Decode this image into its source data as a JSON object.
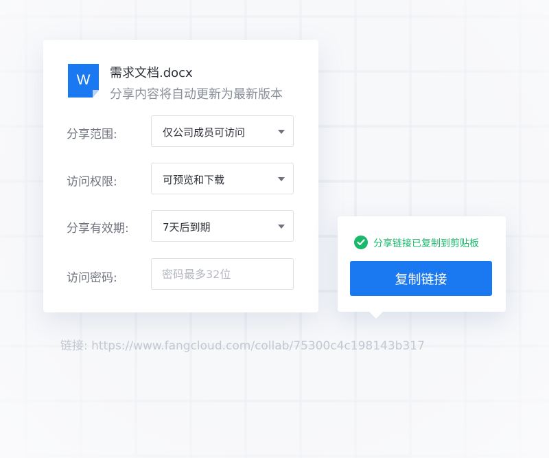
{
  "file": {
    "icon_letter": "W",
    "name": "需求文档.docx",
    "subtitle": "分享内容将自动更新为最新版本"
  },
  "form": {
    "rows": [
      {
        "label": "分享范围:",
        "value": "仅公司成员可访问"
      },
      {
        "label": "访问权限:",
        "value": "可预览和下载"
      },
      {
        "label": "分享有效期:",
        "value": "7天后到期"
      }
    ],
    "password": {
      "label": "访问密码:",
      "placeholder": "密码最多32位"
    }
  },
  "popover": {
    "success_text": "分享链接已复制到剪贴板",
    "button_label": "复制链接"
  },
  "link": {
    "text": "链接: https://www.fangcloud.com/collab/75300c4c198143b317"
  },
  "colors": {
    "primary": "#1a78f0",
    "success": "#19b96b"
  }
}
